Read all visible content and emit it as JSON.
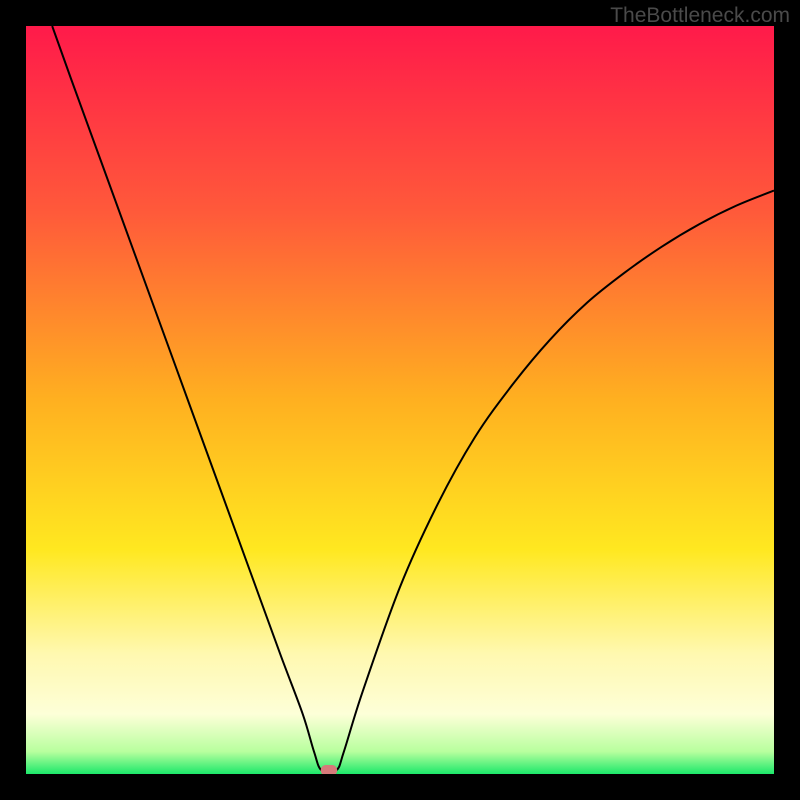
{
  "watermark": "TheBottleneck.com",
  "chart_data": {
    "type": "line",
    "title": "",
    "xlabel": "",
    "ylabel": "",
    "xlim": [
      0,
      100
    ],
    "ylim": [
      0,
      100
    ],
    "background_gradient": {
      "stops": [
        {
          "offset": 0,
          "color": "#ff1a4a"
        },
        {
          "offset": 25,
          "color": "#ff5a3a"
        },
        {
          "offset": 50,
          "color": "#ffb020"
        },
        {
          "offset": 70,
          "color": "#ffe820"
        },
        {
          "offset": 84,
          "color": "#fff8b0"
        },
        {
          "offset": 92,
          "color": "#fdffd8"
        },
        {
          "offset": 97,
          "color": "#b8ff9e"
        },
        {
          "offset": 100,
          "color": "#1ce86a"
        }
      ]
    },
    "series": [
      {
        "name": "bottleneck-curve",
        "type": "line",
        "color": "#000000",
        "points": [
          {
            "x": 3.5,
            "y": 100
          },
          {
            "x": 6,
            "y": 93
          },
          {
            "x": 10,
            "y": 82
          },
          {
            "x": 14,
            "y": 71
          },
          {
            "x": 18,
            "y": 60
          },
          {
            "x": 22,
            "y": 49
          },
          {
            "x": 26,
            "y": 38
          },
          {
            "x": 30,
            "y": 27
          },
          {
            "x": 34,
            "y": 16
          },
          {
            "x": 37,
            "y": 8
          },
          {
            "x": 38.5,
            "y": 3
          },
          {
            "x": 39.5,
            "y": 0.5
          },
          {
            "x": 41.5,
            "y": 0.5
          },
          {
            "x": 42.5,
            "y": 3
          },
          {
            "x": 45,
            "y": 11
          },
          {
            "x": 50,
            "y": 25
          },
          {
            "x": 55,
            "y": 36
          },
          {
            "x": 60,
            "y": 45
          },
          {
            "x": 65,
            "y": 52
          },
          {
            "x": 70,
            "y": 58
          },
          {
            "x": 75,
            "y": 63
          },
          {
            "x": 80,
            "y": 67
          },
          {
            "x": 85,
            "y": 70.5
          },
          {
            "x": 90,
            "y": 73.5
          },
          {
            "x": 95,
            "y": 76
          },
          {
            "x": 100,
            "y": 78
          }
        ]
      }
    ],
    "marker": {
      "x": 40.5,
      "y": 0.5,
      "color": "#d67a7a",
      "width": 2.2,
      "height": 1.4
    }
  }
}
